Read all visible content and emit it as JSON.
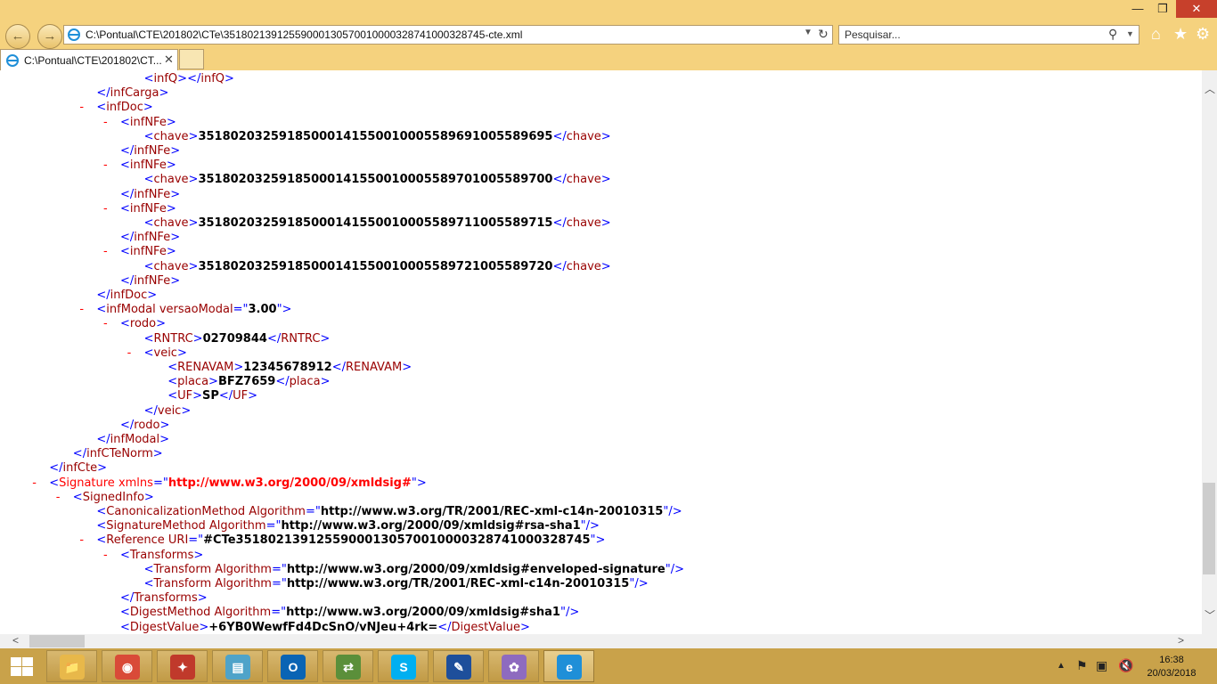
{
  "browser": {
    "address": "C:\\Pontual\\CTE\\201802\\CTe\\35180213912559000130570010000328741000328745-cte.xml",
    "search_placeholder": "Pesquisar...",
    "tab_label": "C:\\Pontual\\CTE\\201802\\CT...",
    "window_controls": {
      "minimize": "—",
      "maximize": "❐",
      "close": "✕"
    },
    "icons": {
      "back": "left-arrow-icon",
      "forward": "right-arrow-icon",
      "refresh": "refresh-icon",
      "search": "magnifier-icon",
      "home": "home-icon",
      "favorites": "star-icon",
      "tools": "gear-icon"
    }
  },
  "xml": {
    "lines": [
      {
        "t": "ov",
        "ind": 6,
        "tag": "infQ",
        "text": "",
        "close": "infQ"
      },
      {
        "t": "c",
        "ind": 4,
        "tag": "infCarga"
      },
      {
        "t": "o",
        "ind": 4,
        "minus": true,
        "tag": "infDoc"
      },
      {
        "t": "o",
        "ind": 5,
        "minus": true,
        "tag": "infNFe"
      },
      {
        "t": "e",
        "ind": 6,
        "tag": "chave",
        "text": "35180203259185000141550010005589691005589695"
      },
      {
        "t": "c",
        "ind": 5,
        "tag": "infNFe"
      },
      {
        "t": "o",
        "ind": 5,
        "minus": true,
        "tag": "infNFe"
      },
      {
        "t": "e",
        "ind": 6,
        "tag": "chave",
        "text": "35180203259185000141550010005589701005589700"
      },
      {
        "t": "c",
        "ind": 5,
        "tag": "infNFe"
      },
      {
        "t": "o",
        "ind": 5,
        "minus": true,
        "tag": "infNFe"
      },
      {
        "t": "e",
        "ind": 6,
        "tag": "chave",
        "text": "35180203259185000141550010005589711005589715"
      },
      {
        "t": "c",
        "ind": 5,
        "tag": "infNFe"
      },
      {
        "t": "o",
        "ind": 5,
        "minus": true,
        "tag": "infNFe"
      },
      {
        "t": "e",
        "ind": 6,
        "tag": "chave",
        "text": "35180203259185000141550010005589721005589720"
      },
      {
        "t": "c",
        "ind": 5,
        "tag": "infNFe"
      },
      {
        "t": "c",
        "ind": 4,
        "tag": "infDoc"
      },
      {
        "t": "o",
        "ind": 4,
        "minus": true,
        "tag": "infModal",
        "attrs": [
          {
            "name": "versaoModal",
            "value": "3.00"
          }
        ]
      },
      {
        "t": "o",
        "ind": 5,
        "minus": true,
        "tag": "rodo"
      },
      {
        "t": "e",
        "ind": 6,
        "tag": "RNTRC",
        "text": "02709844"
      },
      {
        "t": "o",
        "ind": 6,
        "minus": true,
        "tag": "veic"
      },
      {
        "t": "e",
        "ind": 7,
        "tag": "RENAVAM",
        "text": "12345678912"
      },
      {
        "t": "e",
        "ind": 7,
        "tag": "placa",
        "text": "BFZ7659"
      },
      {
        "t": "e",
        "ind": 7,
        "tag": "UF",
        "text": "SP"
      },
      {
        "t": "c",
        "ind": 6,
        "tag": "veic"
      },
      {
        "t": "c",
        "ind": 5,
        "tag": "rodo"
      },
      {
        "t": "c",
        "ind": 4,
        "tag": "infModal"
      },
      {
        "t": "c",
        "ind": 3,
        "tag": "infCTeNorm"
      },
      {
        "t": "c",
        "ind": 2,
        "tag": "infCte"
      },
      {
        "t": "o",
        "ind": 2,
        "minus": true,
        "tag": "Signature",
        "red": true,
        "attrs": [
          {
            "name": "xmlns",
            "value": "http://www.w3.org/2000/09/xmldsig#",
            "red": true
          }
        ]
      },
      {
        "t": "o",
        "ind": 3,
        "minus": true,
        "tag": "SignedInfo"
      },
      {
        "t": "s",
        "ind": 4,
        "tag": "CanonicalizationMethod",
        "attrs": [
          {
            "name": "Algorithm",
            "value": "http://www.w3.org/TR/2001/REC-xml-c14n-20010315"
          }
        ]
      },
      {
        "t": "s",
        "ind": 4,
        "tag": "SignatureMethod",
        "attrs": [
          {
            "name": "Algorithm",
            "value": "http://www.w3.org/2000/09/xmldsig#rsa-sha1"
          }
        ]
      },
      {
        "t": "o",
        "ind": 4,
        "minus": true,
        "tag": "Reference",
        "attrs": [
          {
            "name": "URI",
            "value": "#CTe35180213912559000130570010000328741000328745"
          }
        ]
      },
      {
        "t": "o",
        "ind": 5,
        "minus": true,
        "tag": "Transforms"
      },
      {
        "t": "s",
        "ind": 6,
        "tag": "Transform",
        "attrs": [
          {
            "name": "Algorithm",
            "value": "http://www.w3.org/2000/09/xmldsig#enveloped-signature"
          }
        ]
      },
      {
        "t": "s",
        "ind": 6,
        "tag": "Transform",
        "attrs": [
          {
            "name": "Algorithm",
            "value": "http://www.w3.org/TR/2001/REC-xml-c14n-20010315"
          }
        ]
      },
      {
        "t": "c",
        "ind": 5,
        "tag": "Transforms"
      },
      {
        "t": "s",
        "ind": 5,
        "tag": "DigestMethod",
        "attrs": [
          {
            "name": "Algorithm",
            "value": "http://www.w3.org/2000/09/xmldsig#sha1"
          }
        ]
      },
      {
        "t": "e",
        "ind": 5,
        "tag": "DigestValue",
        "text": "+6YB0WewfFd4DcSnO/vNJeu+4rk="
      }
    ]
  },
  "taskbar": {
    "apps": [
      {
        "name": "file-explorer",
        "icon": "folder-icon",
        "glyph": "📁",
        "color": "#e8b84a"
      },
      {
        "name": "chrome",
        "icon": "chrome-icon",
        "glyph": "◉",
        "color": "#d94a38"
      },
      {
        "name": "app-red",
        "icon": "red-app-icon",
        "glyph": "✦",
        "color": "#c0392b"
      },
      {
        "name": "notepad",
        "icon": "notepad-icon",
        "glyph": "▤",
        "color": "#4fa3c9"
      },
      {
        "name": "outlook",
        "icon": "outlook-icon",
        "glyph": "O",
        "color": "#0a64b4"
      },
      {
        "name": "teamviewer",
        "icon": "network-app-icon",
        "glyph": "⇄",
        "color": "#5b8f3a"
      },
      {
        "name": "skype",
        "icon": "skype-icon",
        "glyph": "S",
        "color": "#00aff0"
      },
      {
        "name": "app-doc",
        "icon": "document-app-icon",
        "glyph": "✎",
        "color": "#1e4f9b"
      },
      {
        "name": "paint",
        "icon": "paint-icon",
        "glyph": "✿",
        "color": "#8e6bbf"
      },
      {
        "name": "internet-explorer",
        "icon": "ie-icon",
        "glyph": "e",
        "color": "#1f8fd8"
      }
    ],
    "time": "16:38",
    "date": "20/03/2018"
  }
}
